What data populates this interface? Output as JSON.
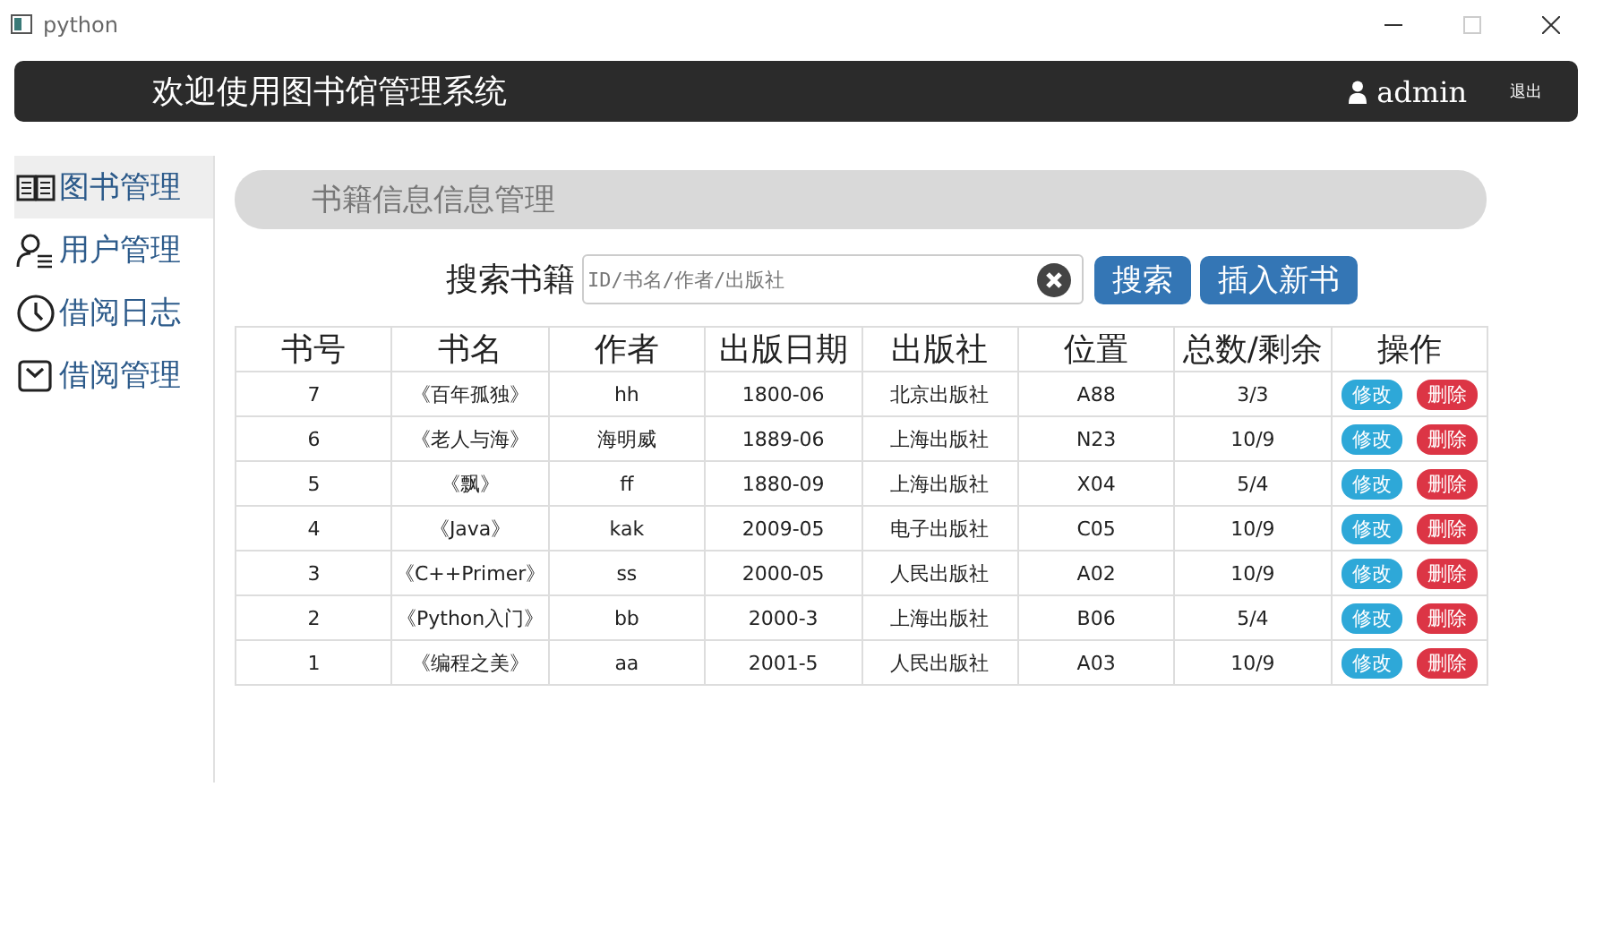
{
  "window": {
    "title": "python"
  },
  "header": {
    "title": "欢迎使用图书馆管理系统",
    "user": "admin",
    "logout": "退出"
  },
  "sidebar": {
    "items": [
      {
        "label": "图书管理",
        "selected": true
      },
      {
        "label": "用户管理",
        "selected": false
      },
      {
        "label": "借阅日志",
        "selected": false
      },
      {
        "label": "借阅管理",
        "selected": false
      }
    ]
  },
  "banner": "书籍信息信息管理",
  "search": {
    "label": "搜索书籍",
    "placeholder": "ID/书名/作者/出版社",
    "buttons": [
      "搜索",
      "插入新书"
    ]
  },
  "table": {
    "columns": [
      "书号",
      "书名",
      "作者",
      "出版日期",
      "出版社",
      "位置",
      "总数/剩余",
      "操作"
    ],
    "rows": [
      {
        "cells": [
          "7",
          "《百年孤独》",
          "hh",
          "1800-06",
          "北京出版社",
          "A88",
          "3/3"
        ],
        "actions": [
          "修改",
          "删除"
        ]
      },
      {
        "cells": [
          "6",
          "《老人与海》",
          "海明威",
          "1889-06",
          "上海出版社",
          "N23",
          "10/9"
        ],
        "actions": [
          "修改",
          "删除"
        ]
      },
      {
        "cells": [
          "5",
          "《飘》",
          "ff",
          "1880-09",
          "上海出版社",
          "X04",
          "5/4"
        ],
        "actions": [
          "修改",
          "删除"
        ]
      },
      {
        "cells": [
          "4",
          "《Java》",
          "kak",
          "2009-05",
          "电子出版社",
          "C05",
          "10/9"
        ],
        "actions": [
          "修改",
          "删除"
        ]
      },
      {
        "cells": [
          "3",
          "《C++Primer》",
          "ss",
          "2000-05",
          "人民出版社",
          "A02",
          "10/9"
        ],
        "actions": [
          "修改",
          "删除"
        ]
      },
      {
        "cells": [
          "2",
          "《Python入门》",
          "bb",
          "2000-3",
          "上海出版社",
          "B06",
          "5/4"
        ],
        "actions": [
          "修改",
          "删除"
        ]
      },
      {
        "cells": [
          "1",
          "《编程之美》",
          "aa",
          "2001-5",
          "人民出版社",
          "A03",
          "10/9"
        ],
        "actions": [
          "修改",
          "删除"
        ]
      }
    ]
  }
}
